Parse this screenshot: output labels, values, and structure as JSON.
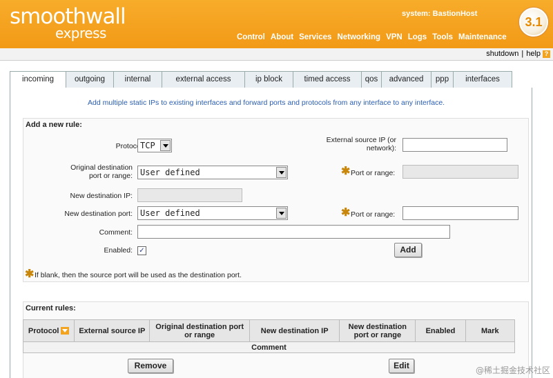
{
  "header": {
    "logo_line1": "smoothwall",
    "logo_line2": "express",
    "system": "system: BastionHost",
    "version": "3.1",
    "nav": [
      "Control",
      "About",
      "Services",
      "Networking",
      "VPN",
      "Logs",
      "Tools",
      "Maintenance"
    ],
    "active_nav": "Networking"
  },
  "subbar": {
    "shutdown": "shutdown",
    "sep": "|",
    "help": "help",
    "help_icon": "?"
  },
  "tabs": [
    {
      "label": "incoming"
    },
    {
      "label": "outgoing"
    },
    {
      "label": "internal"
    },
    {
      "label": "external access"
    },
    {
      "label": "ip block"
    },
    {
      "label": "timed access"
    },
    {
      "label": "qos"
    },
    {
      "label": "advanced"
    },
    {
      "label": "ppp"
    },
    {
      "label": "interfaces"
    }
  ],
  "active_tab": "incoming",
  "description": "Add multiple static IPs to existing interfaces and forward ports and protocols from any interface to any interface.",
  "add_rule": {
    "title": "Add a new rule:",
    "protocol_label": "Protocol:",
    "protocol_value": "TCP",
    "ext_source_label_1": "External source IP (or",
    "ext_source_label_2": "network):",
    "ext_source_value": "",
    "orig_dest_label_1": "Original destination",
    "orig_dest_label_2": "port or range:",
    "orig_dest_value": "User defined",
    "port_range_label": "Port or range:",
    "port_range_1_value": "",
    "new_dest_ip_label": "New destination IP:",
    "new_dest_ip_value": "",
    "new_dest_port_label": "New destination port:",
    "new_dest_port_value": "User defined",
    "port_range_2_value": "",
    "comment_label": "Comment:",
    "comment_value": "",
    "enabled_label": "Enabled:",
    "enabled_checked": true,
    "check_mark": "✓",
    "star": "✱",
    "add_button": "Add",
    "note": "If blank, then the source port will be used as the destination port."
  },
  "current_rules": {
    "title": "Current rules:",
    "columns": [
      "Protocol",
      "External source IP",
      "Original destination port or range",
      "New destination IP",
      "New destination port or range",
      "Enabled",
      "Mark"
    ],
    "comment_header": "Comment",
    "remove_button": "Remove",
    "edit_button": "Edit"
  },
  "watermark": "@稀土掘金技术社区",
  "colors": {
    "header_orange": "#f5a623",
    "link_blue": "#2a5db0",
    "star": "#c8860a"
  }
}
